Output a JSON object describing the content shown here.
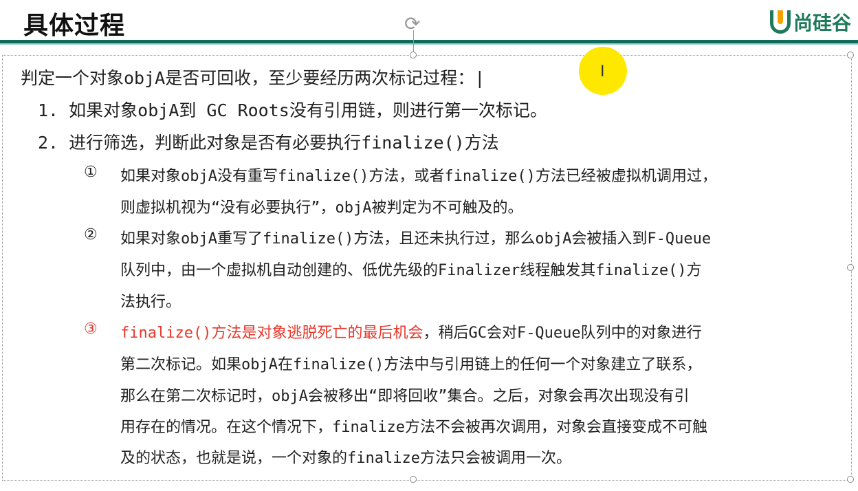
{
  "slide": {
    "title": "具体过程",
    "logo_text": "尚硅谷"
  },
  "intro": "判定一个对象objA是否可回收，至少要经历两次标记过程：|",
  "items": [
    {
      "num": "1.",
      "text": "如果对象objA到 GC Roots没有引用链，则进行第一次标记。"
    },
    {
      "num": "2.",
      "text": "进行筛选，判断此对象是否有必要执行finalize()方法"
    }
  ],
  "subitems": [
    {
      "num": "①",
      "lines": [
        "如果对象objA没有重写finalize()方法，或者finalize()方法已经被虚拟机调用过，",
        "则虚拟机视为“没有必要执行”，objA被判定为不可触及的。"
      ]
    },
    {
      "num": "②",
      "lines": [
        "如果对象objA重写了finalize()方法，且还未执行过，那么objA会被插入到F-Queue",
        "队列中，由一个虚拟机自动创建的、低优先级的Finalizer线程触发其finalize()方",
        "法执行。"
      ]
    },
    {
      "num": "③",
      "highlight": "finalize()方法是对象逃脱死亡的最后机会",
      "first_rest": "，稍后GC会对F-Queue队列中的对象进行",
      "lines": [
        "第二次标记。如果objA在finalize()方法中与引用链上的任何一个对象建立了联系，",
        "那么在第二次标记时，objA会被移出“即将回收”集合。之后，对象会再次出现没有引",
        "用存在的情况。在这个情况下，finalize方法不会被再次调用，对象会直接变成不可触",
        "及的状态，也就是说，一个对象的finalize方法只会被调用一次。"
      ]
    }
  ],
  "colors": {
    "accent": "#0f6b5e",
    "highlight_red": "#e8372b",
    "cursor_highlight": "#ffe800"
  }
}
